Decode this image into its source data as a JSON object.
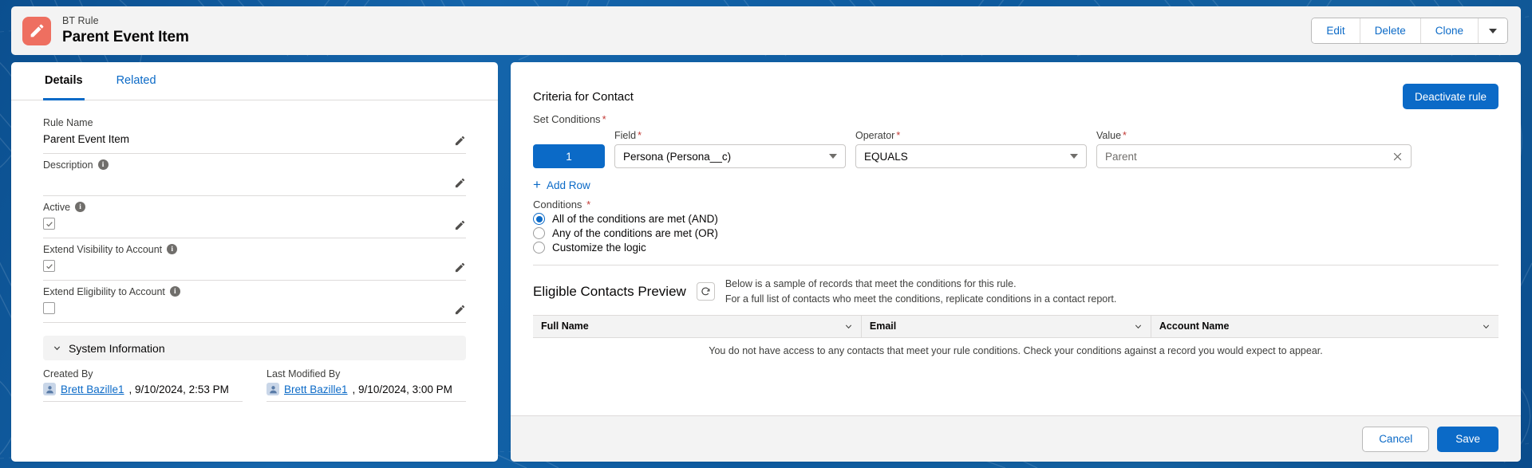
{
  "theme": {
    "brand_blue": "#0b6ac7",
    "background_blue": "#0d5a9e",
    "record_icon_color": "#ee6f60",
    "required_red": "#c23934",
    "panel_grey": "#f3f3f3"
  },
  "record_header": {
    "object_label": "BT Rule",
    "record_name": "Parent Event Item",
    "icon": "pencil-icon",
    "actions": [
      {
        "label": "Edit",
        "name": "edit-button"
      },
      {
        "label": "Delete",
        "name": "delete-button"
      },
      {
        "label": "Clone",
        "name": "clone-button"
      }
    ],
    "more_actions_icon": "chevron-down-icon"
  },
  "left_panel": {
    "tabs": [
      {
        "label": "Details",
        "active": true
      },
      {
        "label": "Related",
        "active": false
      }
    ],
    "fields": [
      {
        "label": "Rule Name",
        "value": "Parent Event Item",
        "type": "text",
        "has_info": false
      },
      {
        "label": "Description",
        "value": "",
        "type": "text",
        "has_info": true
      },
      {
        "label": "Active",
        "value": "",
        "type": "checkbox",
        "checked": true,
        "has_info": true
      },
      {
        "label": "Extend Visibility to Account",
        "value": "",
        "type": "checkbox",
        "checked": true,
        "has_info": true
      },
      {
        "label": "Extend Eligibility to Account",
        "value": "",
        "type": "checkbox",
        "checked": false,
        "has_info": true
      }
    ],
    "system_information": {
      "section_title": "System Information",
      "collapse_icon": "chevron-down-icon",
      "created_by": {
        "label": "Created By",
        "user": "Brett Bazille1",
        "timestamp": ", 9/10/2024, 2:53 PM"
      },
      "last_modified_by": {
        "label": "Last Modified By",
        "user": "Brett Bazille1",
        "timestamp": ", 9/10/2024, 3:00 PM"
      }
    }
  },
  "right_panel": {
    "title": "Criteria for Contact",
    "deactivate_label": "Deactivate rule",
    "set_conditions_label": "Set Conditions",
    "column_labels": {
      "field": "Field",
      "operator": "Operator",
      "value": "Value"
    },
    "condition_rows": [
      {
        "number": "1",
        "field": "Persona (Persona__c)",
        "operator": "EQUALS",
        "value": "Parent"
      }
    ],
    "add_row_label": "Add Row",
    "conditions_label": "Conditions",
    "logic_options": [
      {
        "label": "All of the conditions are met (AND)",
        "selected": true
      },
      {
        "label": "Any of the conditions are met (OR)",
        "selected": false
      },
      {
        "label": "Customize the logic",
        "selected": false
      }
    ],
    "preview": {
      "title": "Eligible Contacts Preview",
      "refresh_icon": "refresh-icon",
      "note_line1": "Below is a sample of records that meet the conditions for this rule.",
      "note_line2": "For a full list of contacts who meet the conditions, replicate conditions in a contact report.",
      "columns": [
        "Full Name",
        "Email",
        "Account Name"
      ],
      "rows": [],
      "empty_message": "You do not have access to any contacts that meet your rule conditions. Check your conditions against a record you would expect to appear."
    },
    "footer": {
      "cancel_label": "Cancel",
      "save_label": "Save"
    }
  }
}
